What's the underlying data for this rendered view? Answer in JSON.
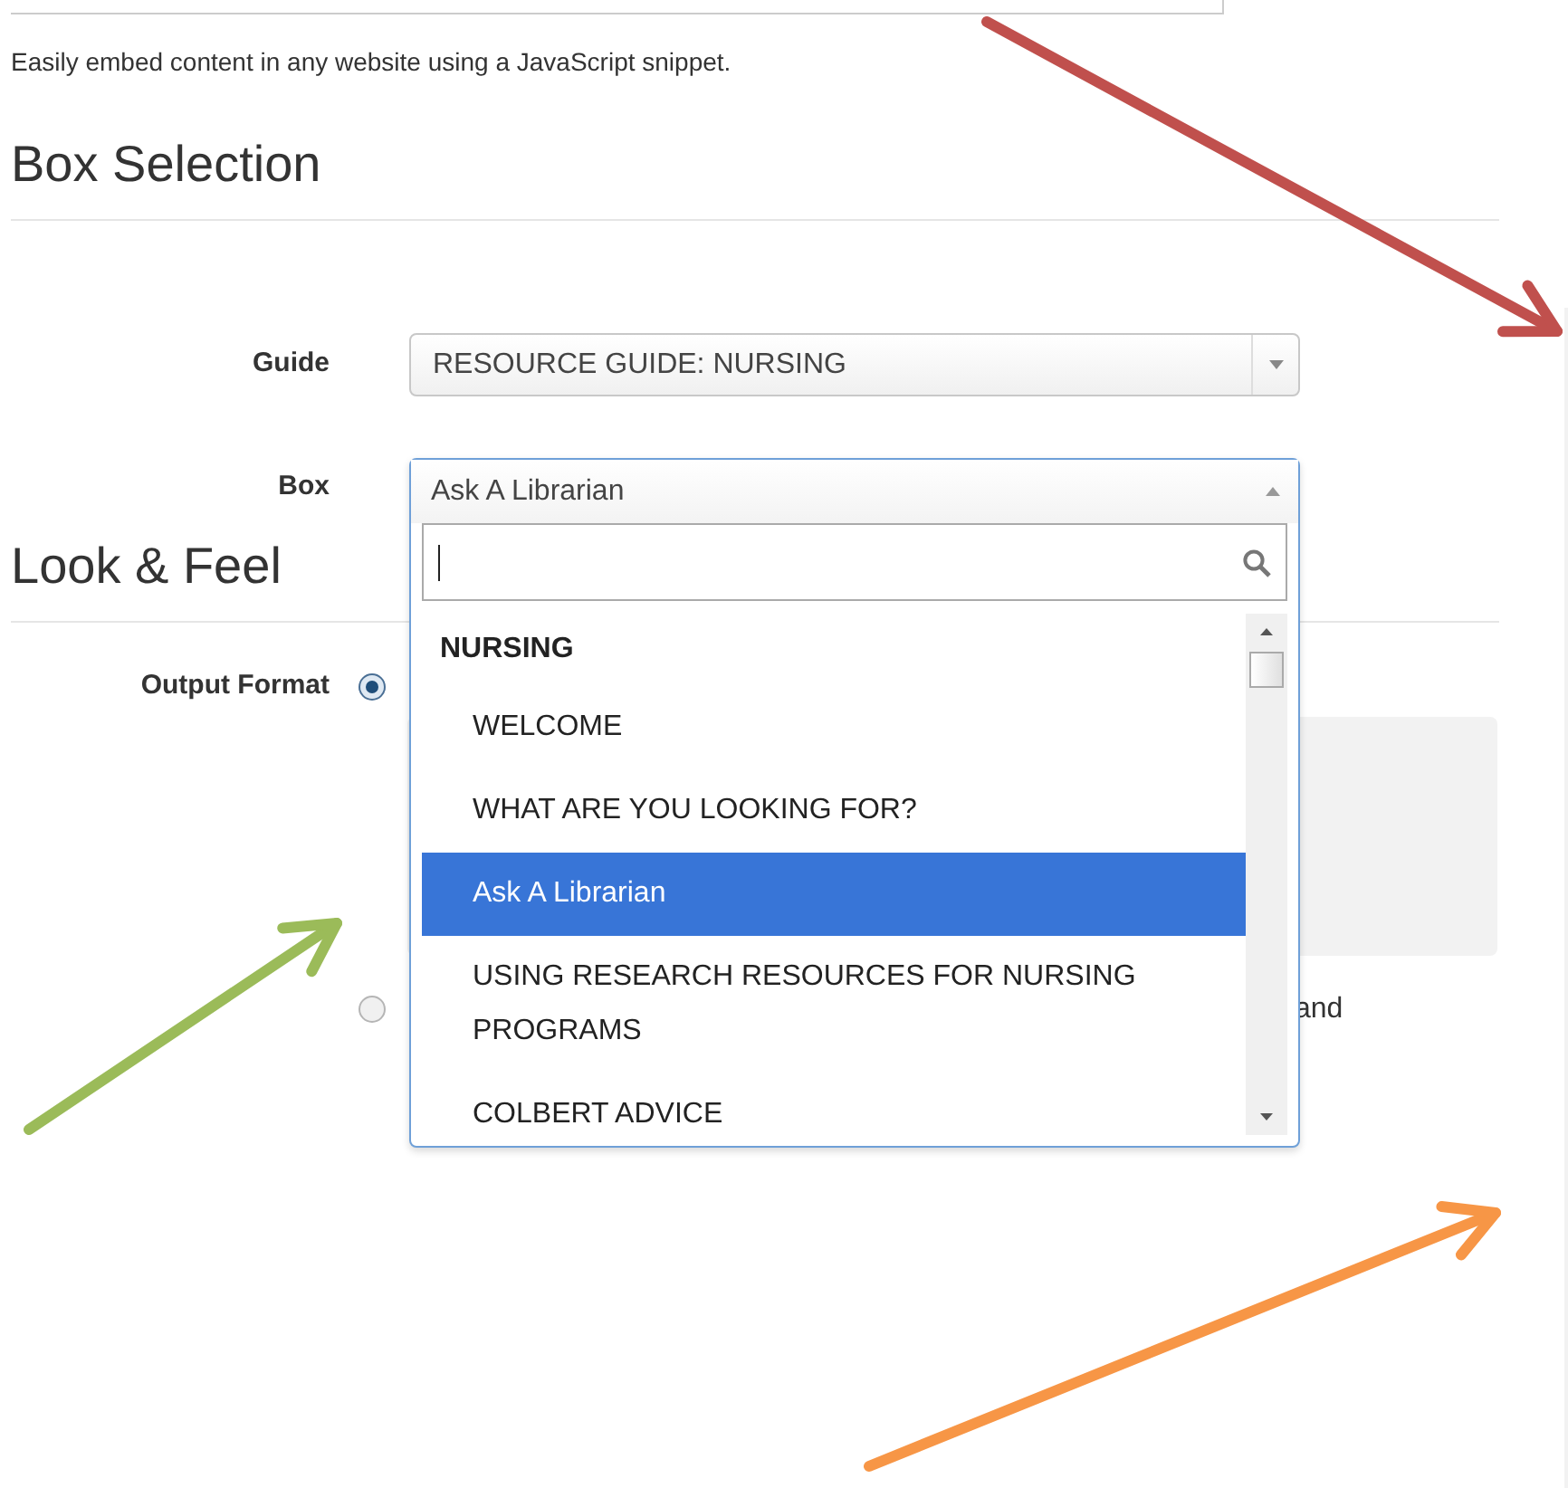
{
  "description": "Easily embed content in any website using a JavaScript snippet.",
  "box_selection": {
    "heading": "Box Selection",
    "guide": {
      "label": "Guide",
      "value": "RESOURCE GUIDE: NURSING"
    },
    "box": {
      "label": "Box",
      "value": "Ask A Librarian",
      "expanded": true,
      "group": "NURSING",
      "options": [
        {
          "label": "WELCOME",
          "selected": false
        },
        {
          "label": "WHAT ARE YOU LOOKING FOR?",
          "selected": false
        },
        {
          "label": "Ask A Librarian",
          "selected": true
        },
        {
          "label": "USING RESEARCH RESOURCES FOR NURSING PROGRAMS",
          "selected": false
        },
        {
          "label": "COLBERT ADVICE",
          "selected": false
        }
      ]
    }
  },
  "look_and_feel": {
    "heading": "Look & Feel",
    "output_format": {
      "label": "Output Format",
      "options": [
        {
          "selected": true
        },
        {
          "selected": false,
          "trailing_text": "and"
        }
      ]
    }
  }
}
